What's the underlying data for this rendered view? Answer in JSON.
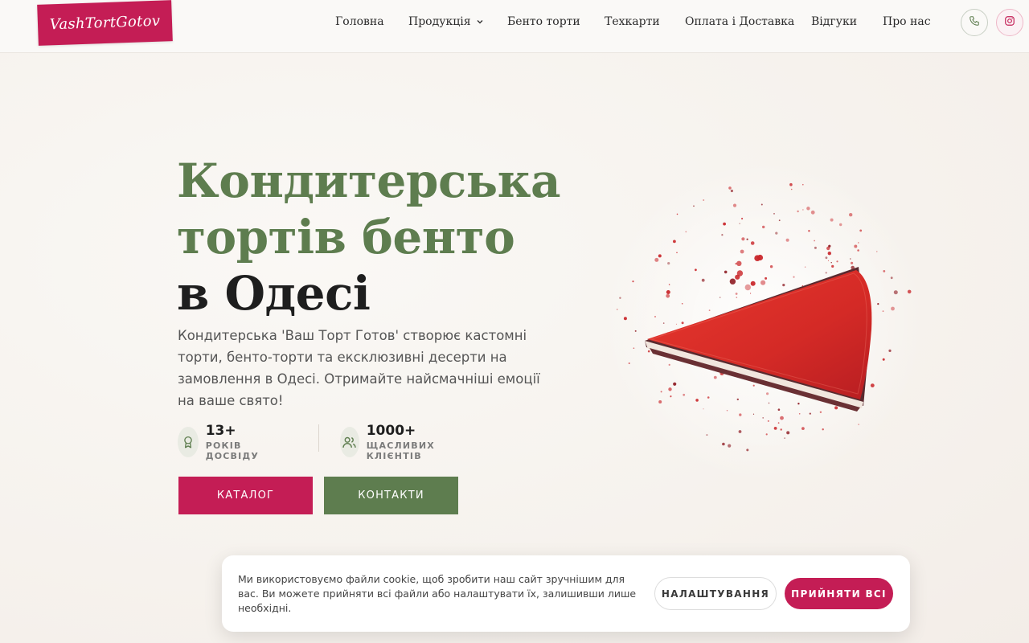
{
  "header": {
    "logo_text": "VashTortGotov",
    "nav": [
      {
        "label": "Головна"
      },
      {
        "label": "Продукція",
        "has_dropdown": true
      },
      {
        "label": "Бенто торти"
      },
      {
        "label": "Техкарти"
      },
      {
        "label": "Оплата і Доставка"
      },
      {
        "label": "Відгуки"
      },
      {
        "label": "Про нас"
      }
    ],
    "icons": [
      "phone-icon",
      "instagram-icon"
    ]
  },
  "hero": {
    "title_line1": "Кондитерська",
    "title_line2": "тортів бенто",
    "title_line3": "в Одесі",
    "description": "Кондитерська 'Ваш Торт Готов' створює кастомні торти, бенто-торти та ексклюзивні десерти на замовлення в Одесі. Отримайте найсмачніші емоції на ваше свято!",
    "stats": [
      {
        "value": "13+",
        "label": "РОКІВ ДОСВІДУ",
        "icon": "award-icon"
      },
      {
        "value": "1000+",
        "label": "ЩАСЛИВИХ КЛІЄНТІВ",
        "icon": "users-icon"
      }
    ],
    "btn_catalog": "КАТАЛОГ",
    "btn_contacts": "КОНТАКТИ"
  },
  "cookie": {
    "text": "Ми використовуємо файли cookie, щоб зробити наш сайт зручнішим для вас. Ви можете прийняти всі файли або налаштувати їх, залишивши лише необхідні.",
    "settings_label": "НАЛАШТУВАННЯ",
    "accept_label": "ПРИЙНЯТИ ВСІ"
  },
  "colors": {
    "brand_pink": "#c41d55",
    "brand_green": "#5e7d4f",
    "background": "#f6f2ed"
  }
}
